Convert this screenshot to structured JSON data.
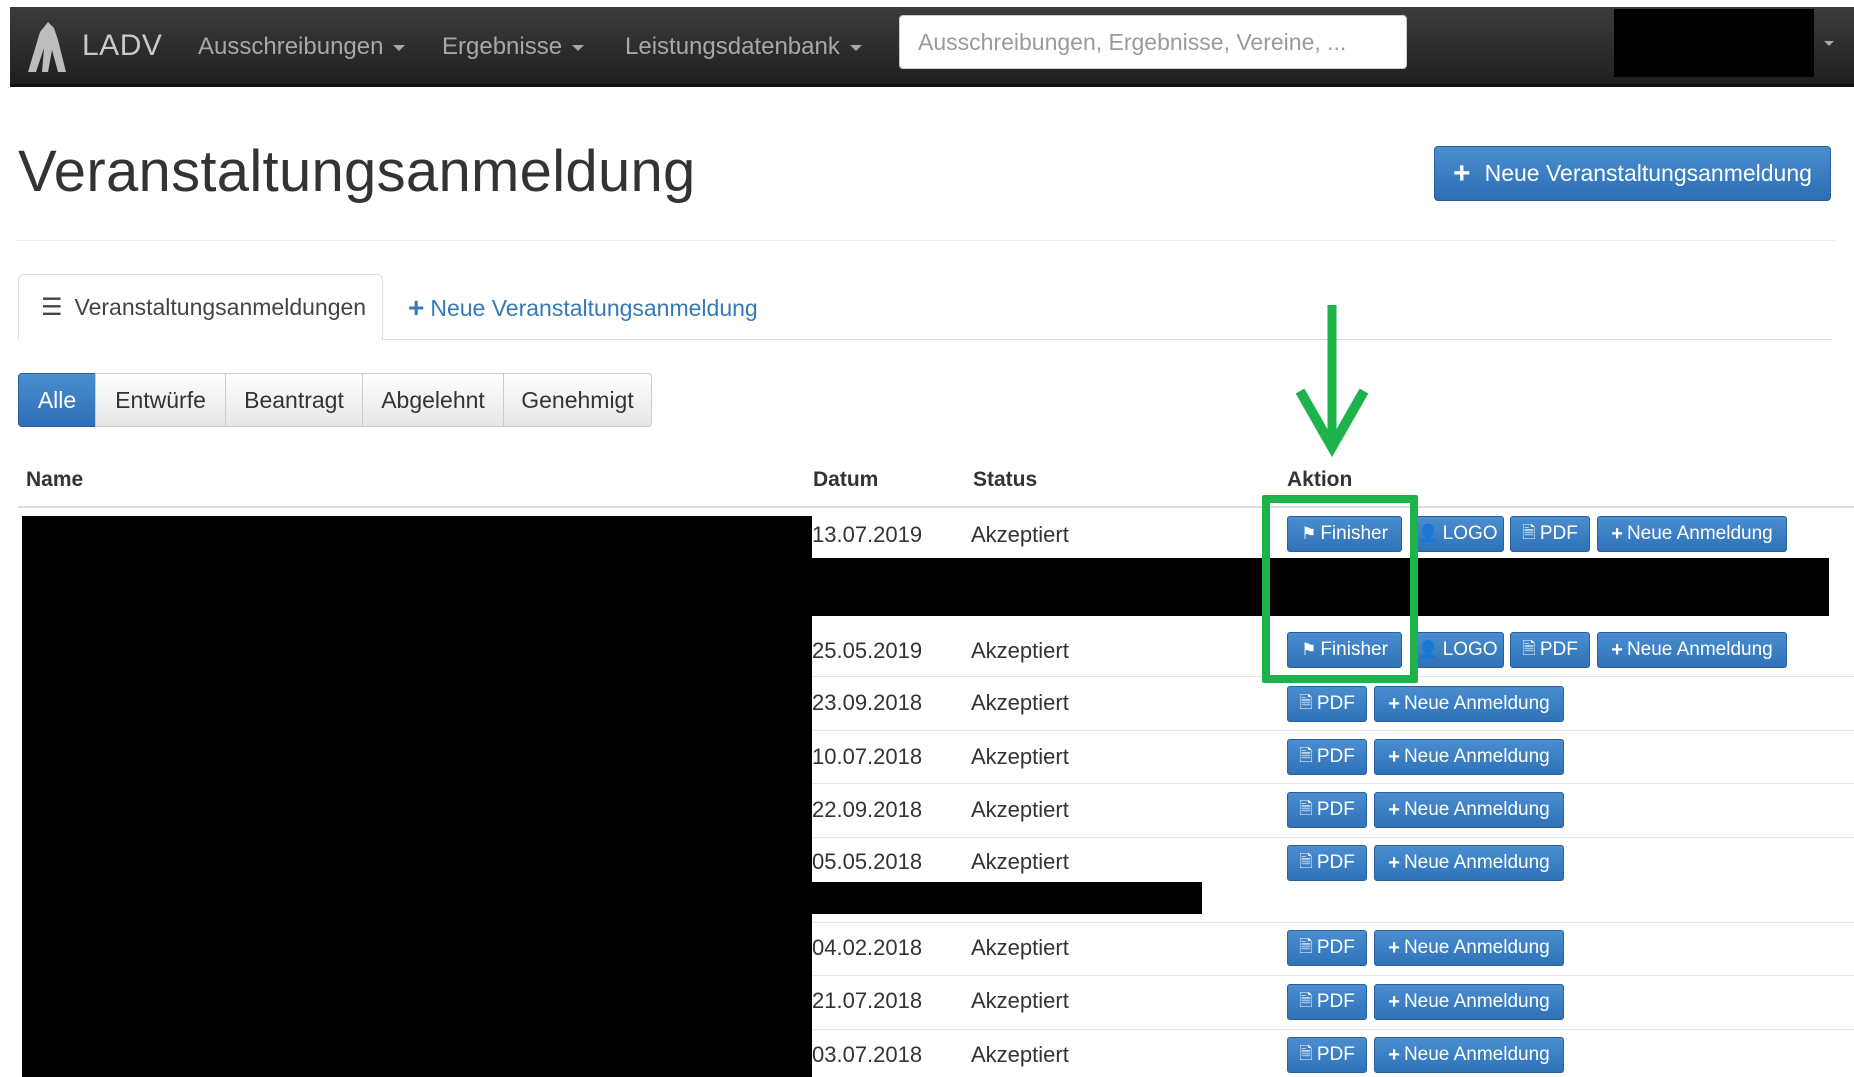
{
  "navbar": {
    "brand": "LADV",
    "items": [
      {
        "label": "Ausschreibungen"
      },
      {
        "label": "Ergebnisse"
      },
      {
        "label": "Leistungsdatenbank"
      }
    ],
    "search_placeholder": "Ausschreibungen, Ergebnisse, Vereine, ..."
  },
  "page": {
    "title": "Veranstaltungsanmeldung",
    "new_button_label": "Neue Veranstaltungsanmeldung"
  },
  "tabs": {
    "list_label": "Veranstaltungsanmeldungen",
    "new_label": "Neue Veranstaltungsanmeldung"
  },
  "filters": [
    "Alle",
    "Entwürfe",
    "Beantragt",
    "Abgelehnt",
    "Genehmigt"
  ],
  "filters_active": "Alle",
  "table": {
    "headers": {
      "name": "Name",
      "datum": "Datum",
      "status": "Status",
      "aktion": "Aktion"
    },
    "rows": [
      {
        "datum": "13.07.2019",
        "status": "Akzeptiert",
        "actions": [
          "Finisher",
          "LOGO",
          "PDF",
          "Neue Anmeldung"
        ]
      },
      {
        "datum": "25.05.2019",
        "status": "Akzeptiert",
        "actions": [
          "Finisher",
          "LOGO",
          "PDF",
          "Neue Anmeldung"
        ]
      },
      {
        "datum": "23.09.2018",
        "status": "Akzeptiert",
        "actions": [
          "PDF",
          "Neue Anmeldung"
        ]
      },
      {
        "datum": "10.07.2018",
        "status": "Akzeptiert",
        "actions": [
          "PDF",
          "Neue Anmeldung"
        ]
      },
      {
        "datum": "22.09.2018",
        "status": "Akzeptiert",
        "actions": [
          "PDF",
          "Neue Anmeldung"
        ]
      },
      {
        "datum": "05.05.2018",
        "status": "Akzeptiert",
        "actions": [
          "PDF",
          "Neue Anmeldung"
        ]
      },
      {
        "datum": "04.02.2018",
        "status": "Akzeptiert",
        "actions": [
          "PDF",
          "Neue Anmeldung"
        ]
      },
      {
        "datum": "21.07.2018",
        "status": "Akzeptiert",
        "actions": [
          "PDF",
          "Neue Anmeldung"
        ]
      },
      {
        "datum": "03.07.2018",
        "status": "Akzeptiert",
        "actions": [
          "PDF",
          "Neue Anmeldung"
        ]
      }
    ]
  },
  "colors": {
    "primary": "#337ab7",
    "navbar": "#2a2a2a",
    "annotation": "#1eb34a"
  },
  "icons": {
    "finisher": "flag-icon",
    "logo": "user-icon",
    "pdf": "file-icon",
    "new": "plus-icon",
    "menu": "list-icon"
  }
}
